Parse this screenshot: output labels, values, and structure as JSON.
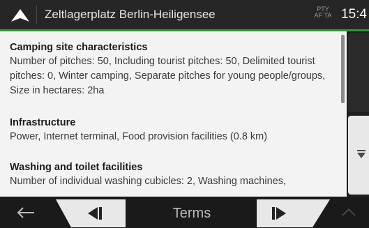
{
  "header": {
    "title": "Zeltlagerplatz Berlin-Heiligensee",
    "badge_line1": "PTY",
    "badge_line2": "AF TA",
    "time": "15:4"
  },
  "sections": [
    {
      "heading": "Camping site characteristics",
      "body": "Number of pitches: 50, Including tourist pitches: 50, Delimited tourist pitches: 0, Winter camping, Separate pitches for young people/groups, Size in hectares: 2ha"
    },
    {
      "heading": "Infrastructure",
      "body": "Power, Internet terminal, Food provision facilities (0.8 km)"
    },
    {
      "heading": "Washing and toilet facilities",
      "body": "Number of individual washing cubicles: 2, Washing machines,"
    }
  ],
  "footer": {
    "center_label": "Terms"
  },
  "icons": {
    "nav": "navigation-arrow-icon",
    "back": "back-arrow-icon",
    "prev": "previous-icon",
    "next": "next-icon",
    "scroll_down": "scroll-down-icon",
    "up": "chevron-up-icon"
  },
  "colors": {
    "accent_green": "#2f9a37",
    "content_bg": "#f3f3f3",
    "bar_bg": "#262626"
  }
}
